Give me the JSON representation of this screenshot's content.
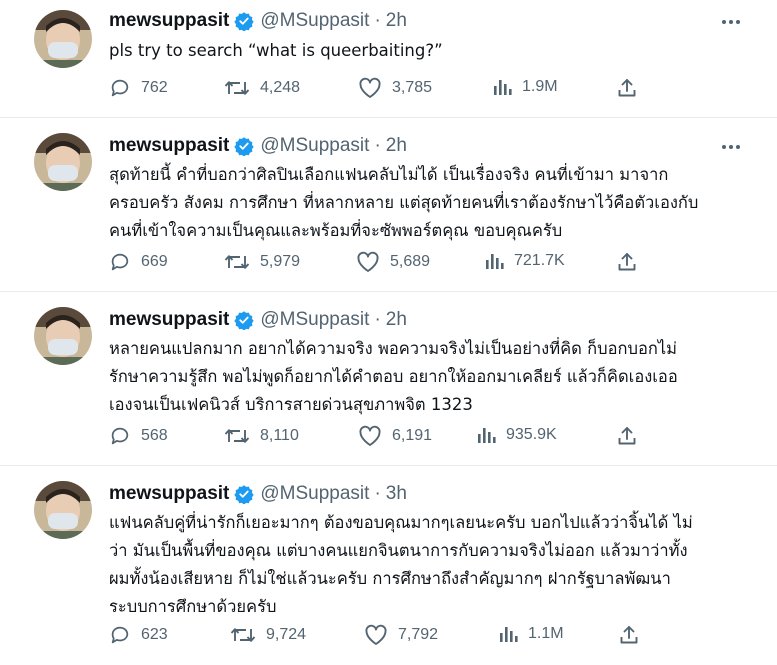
{
  "tweets": [
    {
      "display_name": "mewsuppasit",
      "handle": "@MSuppasit",
      "time": "2h",
      "lines": [
        "pls try to search “what is queerbaiting?”"
      ],
      "replies": "762",
      "retweets": "4,248",
      "likes": "3,785",
      "views": "1.9M"
    },
    {
      "display_name": "mewsuppasit",
      "handle": "@MSuppasit",
      "time": "2h",
      "lines": [
        "สุดท้ายนี้ คำที่บอกว่าศิลปินเลือกแฟนคลับไม่ได้ เป็นเรื่องจริง คนที่เข้ามา มาจาก",
        "ครอบครัว สังคม การศึกษา ที่หลากหลาย แต่สุดท้ายคนที่เราต้องรักษาไว้คือตัวเองกับ",
        "คนที่เข้าใจความเป็นคุณและพร้อมที่จะซัพพอร์ตคุณ ขอบคุณครับ"
      ],
      "replies": "669",
      "retweets": "5,979",
      "likes": "5,689",
      "views": "721.7K"
    },
    {
      "display_name": "mewsuppasit",
      "handle": "@MSuppasit",
      "time": "2h",
      "lines": [
        "หลายคนแปลกมาก อยากได้ความจริง พอความจริงไม่เป็นอย่างที่คิด ก็บอกบอกไม่",
        "รักษาความรู้สึก พอไม่พูดก็อยากได้คำตอบ อยากให้ออกมาเคลียร์ แล้วก็คิดเองเออ",
        "เองจนเป็นเฟคนิวส์ บริการสายด่วนสุขภาพจิต 1323"
      ],
      "replies": "568",
      "retweets": "8,110",
      "likes": "6,191",
      "views": "935.9K"
    },
    {
      "display_name": "mewsuppasit",
      "handle": "@MSuppasit",
      "time": "3h",
      "lines": [
        "แฟนคลับคู่ที่น่ารักก็เยอะมากๆ ต้องขอบคุณมากๆเลยนะครับ บอกไปแล้วว่าจิ้นได้ ไม่",
        "ว่า มันเป็นพื้นที่ของคุณ แต่บางคนแยกจินตนาการกับความจริงไม่ออก แล้วมาว่าทั้ง",
        "ผมทั้งน้องเสียหาย ก็ไม่ใช่แล้วนะครับ การศึกษาถึงสำคัญมากๆ ฝากรัฐบาลพัฒนา",
        "ระบบการศึกษาด้วยครับ"
      ],
      "replies": "623",
      "retweets": "9,724",
      "likes": "7,792",
      "views": "1.1M"
    }
  ],
  "icons": {
    "verified": "verified-badge-icon",
    "more": "more-options-icon",
    "reply": "reply-icon",
    "retweet": "retweet-icon",
    "like": "like-icon",
    "views": "views-icon",
    "share": "share-icon"
  },
  "colors": {
    "verified_blue": "#1d9bf0",
    "text_primary": "#0f1419",
    "text_secondary": "#536471",
    "divider": "#e6ecf0"
  }
}
